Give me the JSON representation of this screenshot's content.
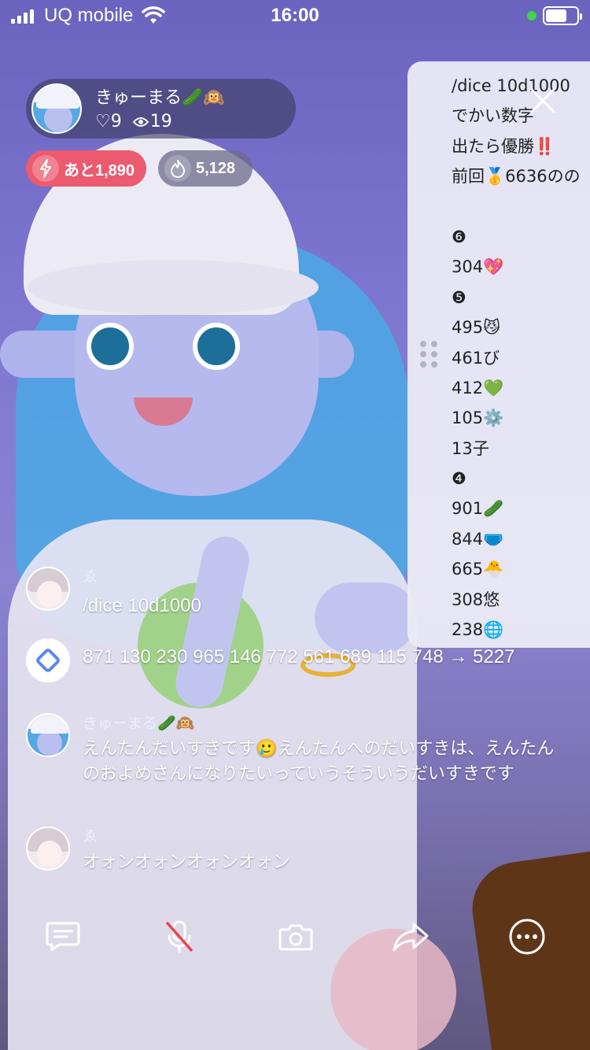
{
  "status_bar": {
    "carrier": "UQ mobile",
    "time": "16:00"
  },
  "host": {
    "name": "きゅーまる🥒🙉",
    "likes": "♡9",
    "viewers": "19"
  },
  "pills": {
    "rank_remaining": "あと1,890",
    "points": "5,128"
  },
  "note_panel": {
    "lines": [
      "/dice 10d1000",
      "でかい数字",
      "出たら優勝‼️",
      "前回🥇6636のの",
      "",
      "❻",
      "304💖",
      "❺",
      "495😼",
      "461び",
      "412💚",
      "105⚙️",
      "13子",
      "❹",
      "901🥒",
      "844🩲",
      "665🐣",
      "308悠",
      "238🌐"
    ]
  },
  "chat": [
    {
      "user": "ゑ",
      "text": "/dice 10d1000"
    },
    {
      "user": "",
      "text": "871 130 230 965 146 772 561 689 115 748 → 5227"
    },
    {
      "user": "きゅーまる🥒🙉",
      "text": "えんたんだいすきです🥲えんたんへのだいすきは、えんたんのおよめさんになりたいっていうそういうだいすきです"
    },
    {
      "user": "ゑ",
      "text": "オォンオォンオォンオォン"
    }
  ]
}
